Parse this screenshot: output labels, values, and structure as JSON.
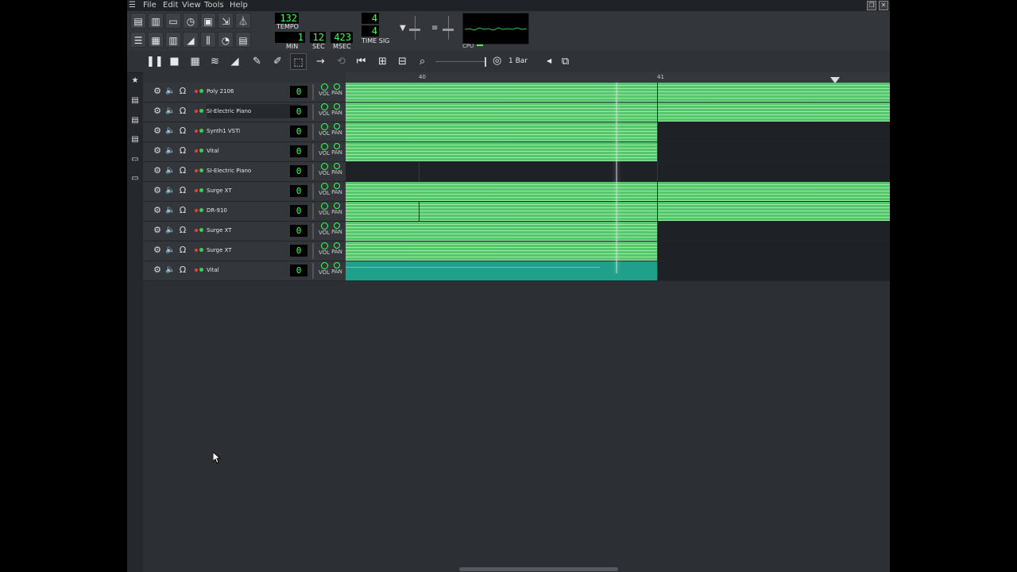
{
  "menu": [
    "File",
    "Edit",
    "View",
    "Tools",
    "Help"
  ],
  "tempo": {
    "value": "132",
    "label": "TEMPO"
  },
  "time": {
    "min": "1",
    "sec": "12",
    "msec": "423",
    "min_label": "MIN",
    "sec_label": "SEC",
    "msec_label": "MSEC"
  },
  "time_sig": {
    "num": "4",
    "den": "4",
    "label": "TIME SIG"
  },
  "cpu": {
    "label": "CPU"
  },
  "song_editor": {
    "quantize": "1 Bar"
  },
  "ruler": {
    "bar_a": "40",
    "bar_b": "41"
  },
  "tracks": [
    {
      "name": "Poly 2106",
      "count": "0",
      "vol": "VOL",
      "pan": "PAN"
    },
    {
      "name": "SI-Electric Piano",
      "count": "0",
      "vol": "VOL",
      "pan": "PAN"
    },
    {
      "name": "Synth1 VSTi",
      "count": "0",
      "vol": "VOL",
      "pan": "PAN"
    },
    {
      "name": "Vital",
      "count": "0",
      "vol": "VOL",
      "pan": "PAN"
    },
    {
      "name": "SI-Electric Piano",
      "count": "0",
      "vol": "VOL",
      "pan": "PAN"
    },
    {
      "name": "Surge XT",
      "count": "0",
      "vol": "VOL",
      "pan": "PAN"
    },
    {
      "name": "DR-910",
      "count": "0",
      "vol": "VOL",
      "pan": "PAN"
    },
    {
      "name": "Surge XT",
      "count": "0",
      "vol": "VOL",
      "pan": "PAN"
    },
    {
      "name": "Surge XT",
      "count": "0",
      "vol": "VOL",
      "pan": "PAN"
    },
    {
      "name": "Vital",
      "count": "0",
      "vol": "VOL",
      "pan": "PAN"
    }
  ],
  "colors": {
    "clip": "#52c86a",
    "clip_teal": "#1fa08a",
    "lcd": "#3dff5a",
    "background": "#2c3035"
  }
}
